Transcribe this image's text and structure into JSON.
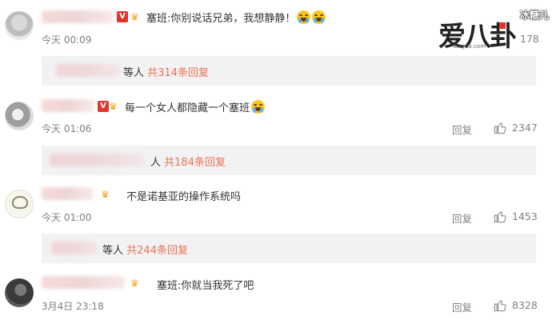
{
  "comments": [
    {
      "text": "塞班:你别说话兄弟，我想静静！",
      "time": "今天 00:09",
      "like_count": "178",
      "reply_who": "等人",
      "reply_count": "共314条回复",
      "emojis": [
        "crying-face",
        "crying-face"
      ]
    },
    {
      "text": "每一个女人都隐藏一个塞班",
      "time": "今天 01:06",
      "reply_label": "回复",
      "like_count": "2347",
      "reply_who": "人",
      "reply_count": "共184条回复",
      "emojis": [
        "laughing-face"
      ]
    },
    {
      "text": "不是诺基亚的操作系统吗",
      "time": "今天 01:00",
      "reply_label": "回复",
      "like_count": "1453",
      "reply_who": "等人",
      "reply_count": "共244条回复"
    },
    {
      "text": "塞班:你就当我死了吧",
      "time": "3月4日 23:18",
      "reply_label": "回复",
      "like_count": "8328"
    }
  ],
  "watermark": {
    "main": "爱八卦",
    "url": "ibaguа.com",
    "tag": "冰糖儿"
  },
  "colors": {
    "link": "#eb7350",
    "muted": "#808080",
    "reply_bg": "#f2f2f5",
    "vip_red": "#e0342c"
  },
  "icons": {
    "like": "thumbs-up-icon",
    "vip": "vip-badge-icon",
    "crown": "crown-badge-icon"
  }
}
